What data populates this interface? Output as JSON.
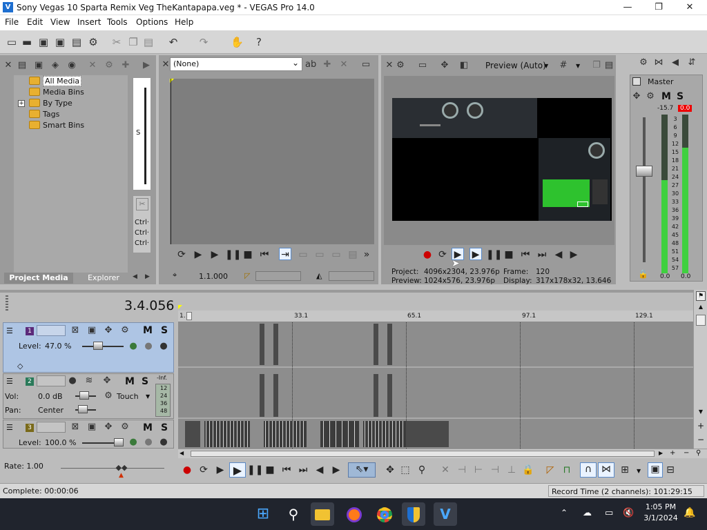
{
  "window": {
    "title": "Sony Vegas 10 Sparta Remix Veg TheKantapapa.veg * - VEGAS Pro 14.0",
    "logo_letter": "V",
    "minimize": "—",
    "maximize": "❐",
    "close": "✕"
  },
  "menu": [
    "File",
    "Edit",
    "View",
    "Insert",
    "Tools",
    "Options",
    "Help"
  ],
  "media": {
    "items": [
      "All Media",
      "Media Bins",
      "By Type",
      "Tags",
      "Smart Bins"
    ],
    "expander": "+",
    "tabs": [
      "Project Media",
      "Explorer"
    ]
  },
  "side_strip": {
    "letter": "S",
    "ctrl": [
      "Ctrl·",
      "Ctrl·",
      "Ctrl·"
    ]
  },
  "trimmer": {
    "selector": "(None)",
    "timecode": "1.1.000",
    "chevron": "⌄"
  },
  "preview": {
    "mode": "Preview (Auto)",
    "project_label": "Project:",
    "project_val": "4096x2304, 23.976p",
    "preview_label": "Preview:",
    "preview_val": "1024x576, 23.976p",
    "frame_label": "Frame:",
    "frame_val": "120",
    "display_label": "Display:",
    "display_val": "317x178x32, 13.646"
  },
  "mixer": {
    "title": "Master",
    "level_left": "-15.7",
    "level_right": "0.0",
    "scale": [
      "3",
      "6",
      "9",
      "12",
      "15",
      "18",
      "21",
      "24",
      "27",
      "30",
      "33",
      "36",
      "39",
      "42",
      "45",
      "48",
      "51",
      "54",
      "57"
    ],
    "bottom_left": "0.0",
    "bottom_right": "0.0",
    "m": "M",
    "s": "S"
  },
  "timeline": {
    "position": "3.4.056",
    "ruler": [
      "1.",
      "33.1",
      "65.1",
      "97.1",
      "129.1"
    ],
    "tracks": [
      {
        "num": "1",
        "level_label": "Level:",
        "level_val": "47.0 %",
        "m": "M",
        "s": "S"
      },
      {
        "num": "2",
        "vol_label": "Vol:",
        "vol_val": "0.0 dB",
        "pan_label": "Pan:",
        "pan_val": "Center",
        "touch": "Touch",
        "inf": "-Inf.",
        "meter": [
          "12",
          "24",
          "36",
          "48"
        ],
        "m": "M",
        "s": "S"
      },
      {
        "num": "3",
        "level_label": "Level:",
        "level_val": "100.0 %",
        "m": "M",
        "s": "S"
      }
    ]
  },
  "rate": {
    "label": "Rate: 1.00"
  },
  "status": {
    "complete": "Complete: 00:00:06",
    "record": "Record Time (2 channels): 101:29:15"
  },
  "taskbar": {
    "time": "1:05 PM",
    "date": "3/1/2024"
  }
}
